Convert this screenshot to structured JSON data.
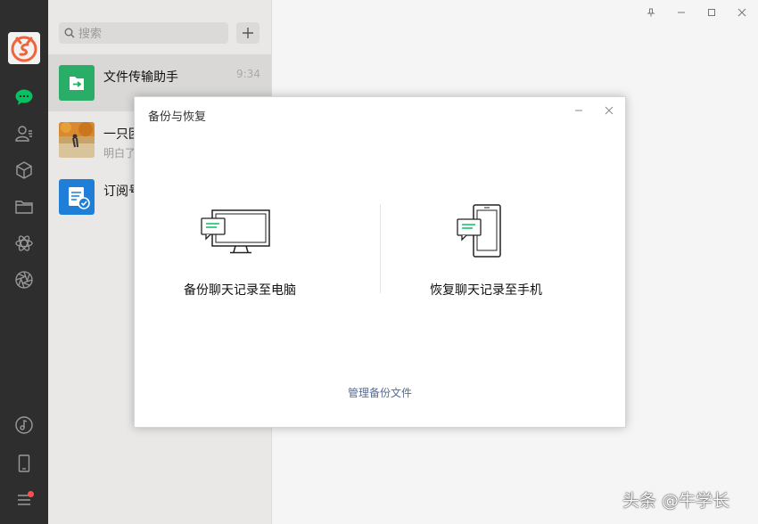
{
  "search": {
    "placeholder": "搜索"
  },
  "chats": [
    {
      "name": "文件传输助手",
      "preview": "",
      "time": "9:34"
    },
    {
      "name": "一只团",
      "preview": "明白了",
      "time": ""
    },
    {
      "name": "订阅号",
      "preview": "",
      "time": ""
    }
  ],
  "dialog": {
    "title": "备份与恢复",
    "backup_label": "备份聊天记录至电脑",
    "restore_label": "恢复聊天记录至手机",
    "manage_link": "管理备份文件"
  },
  "watermark": "头条 @牛学长",
  "colors": {
    "sidebar": "#2e2e2e",
    "accent_green": "#07c160",
    "link": "#576b95",
    "badge": "#fa5151"
  }
}
